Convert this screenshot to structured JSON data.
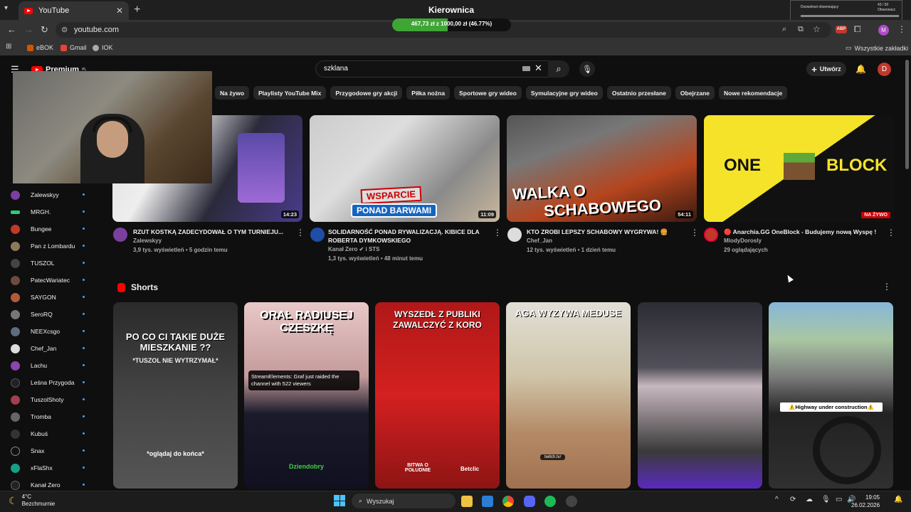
{
  "browser": {
    "tab_title": "YouTube",
    "window_title": "Kierownica",
    "url": "youtube.com",
    "donation_text": "467,73 zł z 1000,00 zł (46.77%)",
    "donation_progress": 0.4677,
    "bookmarks": [
      "eBOK",
      "Gmail",
      "IOK"
    ],
    "all_bookmarks": "Wszystkie zakładki",
    "profile_initial": "M",
    "abp": "ABP"
  },
  "overlay": {
    "left": "Dozwolowi obserwujący",
    "count": "43 / 50",
    "right": "Obserwacz"
  },
  "youtube": {
    "logo_text": "Premium",
    "logo_region": "PL",
    "search_value": "szklana",
    "create_label": "Utwórz",
    "avatar_initial": "D",
    "chips": [
      "Na żywo",
      "Playlisty YouTube Mix",
      "Przygodowe gry akcji",
      "Piłka nożna",
      "Sportowe gry wideo",
      "Symulacyjne gry wideo",
      "Ostatnio przesłane",
      "Obejrzane",
      "Nowe rekomendacje"
    ],
    "sidebar_channels": [
      "Zalewskyy",
      "MRGH.",
      "Bungee",
      "Pan z Lombardu",
      "TUSZOL",
      "PatecWariatec",
      "SAYGON",
      "SeroRQ",
      "NEEXcsgo",
      "Chef_Jan",
      "Lachu",
      "Leśna Przygoda",
      "TuszolShoty",
      "Tromba",
      "Kubuś",
      "Snax",
      "xFlaShx",
      "Kanał Zero"
    ],
    "videos": [
      {
        "title": "RZUT KOSTKĄ ZADECYDOWAŁ O TYM TURNIEJU...",
        "channel": "Zalewskyy",
        "meta": "3,9 tys. wyświetleń • 5 godzin temu",
        "duration": "14:23",
        "thumb_text": "",
        "thumb_text2": ""
      },
      {
        "title": "SOLIDARNOŚĆ PONAD RYWALIZACJĄ. KIBICE DLA ROBERTA DYMKOWSKIEGO",
        "channel": "Kanał Zero ✔ i STS",
        "meta": "1,3 tys. wyświetleń • 48 minut temu",
        "duration": "11:09",
        "thumb_text": "WSPARCIE",
        "thumb_text2": "PONAD BARWAMI"
      },
      {
        "title": "KTO ZROBI LEPSZY SCHABOWY WYGRYWA! 🍔",
        "channel": "Chef_Jan",
        "meta": "12 tys. wyświetleń • 1 dzień temu",
        "duration": "54:11",
        "thumb_text": "WALKA O",
        "thumb_text2": "SCHABOWEGO"
      },
      {
        "title": "🔴 Anarchia.GG OneBlock - Budujemy nową Wyspę !",
        "channel": "MlodyDorosly",
        "meta": "29 oglądających",
        "duration": "NA ŻYWO",
        "thumb_text": "ONE",
        "thumb_text2": "BLOCK"
      }
    ],
    "shorts_heading": "Shorts",
    "shorts": [
      {
        "caption": "PO CO CI TAKIE DUŻE MIESZKANIE ??",
        "sub": "*TUSZOL NIE WYTRZYMAŁ*",
        "bottom": "*oglądaj do końca*"
      },
      {
        "caption": "ORAŁ RADIUSEJ CZESZKĘ",
        "sub": "StreamElements: Graf just raided the channel with 522 viewers",
        "bottom": "Dziendobry"
      },
      {
        "caption": "WYSZEDŁ Z PUBLIKI ZAWALCZYĆ Z KORO",
        "sub": "Betclic",
        "bottom": "BITWA O POŁUDNIE"
      },
      {
        "caption": "AGA WYZYWA MEDUSE",
        "sub": "",
        "bottom": "twitch.tv/"
      },
      {
        "caption": "",
        "sub": "",
        "bottom": ""
      },
      {
        "caption": "",
        "sub": "",
        "bottom": "⚠️Highway under construction⚠️"
      }
    ]
  },
  "taskbar": {
    "weather_temp": "4°C",
    "weather_desc": "Bezchmurnie",
    "search_label": "Wyszukaj",
    "time": "19:05",
    "date": "26.02.2026"
  }
}
